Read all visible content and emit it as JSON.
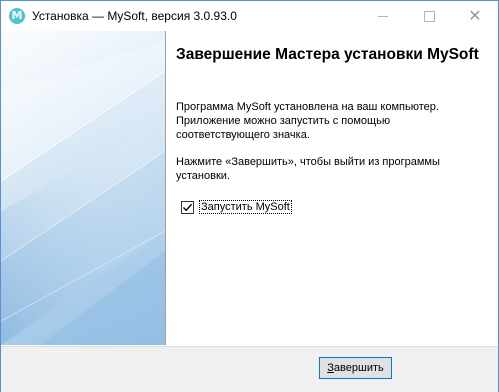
{
  "window": {
    "title": "Установка — MySoft, версия 3.0.93.0",
    "icon_letter": "M",
    "accent_color": "#0078d7",
    "icon_color": "#4fc3d6"
  },
  "titlebar_buttons": {
    "minimize_icon": "minimize-icon",
    "maximize_icon": "maximize-icon",
    "close_icon": "close-icon",
    "close_glyph": "✕"
  },
  "content": {
    "heading": "Завершение Мастера установки MySoft",
    "paragraph1": "Программа MySoft установлена на ваш компьютер.\nПриложение можно запустить с помощью\nсоответствующего значка.",
    "paragraph2": "Нажмите «Завершить», чтобы выйти из программы\nустановки.",
    "launch_checkbox": {
      "label": "Запустить MySoft",
      "checked": true
    }
  },
  "footer": {
    "finish_button_label_first": "З",
    "finish_button_label_rest": "авершить"
  }
}
